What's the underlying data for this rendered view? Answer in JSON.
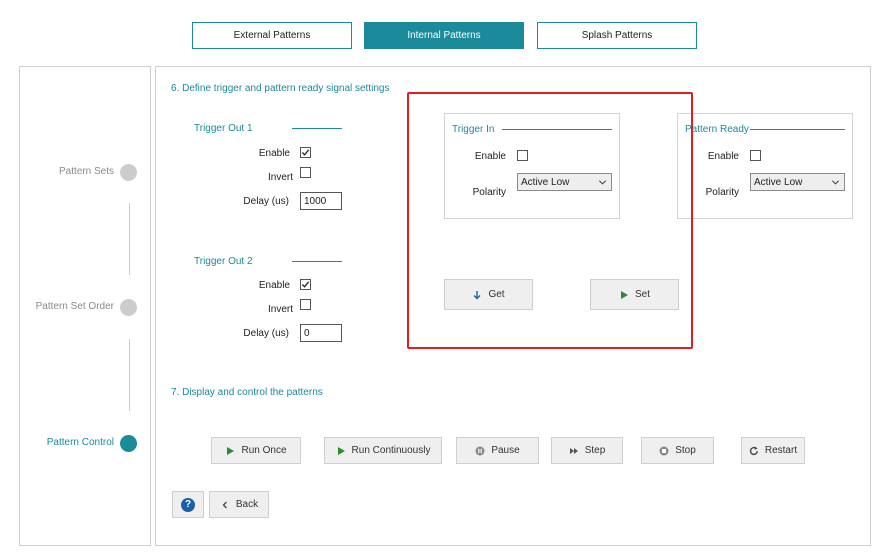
{
  "tabs": [
    {
      "label": "External Patterns",
      "active": false
    },
    {
      "label": "Internal Patterns",
      "active": true
    },
    {
      "label": "Splash Patterns",
      "active": false
    }
  ],
  "steps": [
    {
      "label": "Pattern Sets",
      "active": false
    },
    {
      "label": "Pattern Set Order",
      "active": false
    },
    {
      "label": "Pattern Control",
      "active": true
    }
  ],
  "section6": {
    "title": "6. Define trigger and pattern ready signal settings",
    "trigger_out_1": {
      "title": "Trigger Out 1",
      "enable_label": "Enable",
      "enable_checked": true,
      "invert_label": "Invert",
      "invert_checked": false,
      "delay_label": "Delay (us)",
      "delay_value": "1000"
    },
    "trigger_out_2": {
      "title": "Trigger Out 2",
      "enable_label": "Enable",
      "enable_checked": true,
      "invert_label": "Invert",
      "invert_checked": false,
      "delay_label": "Delay (us)",
      "delay_value": "0"
    },
    "trigger_in": {
      "title": "Trigger In",
      "enable_label": "Enable",
      "enable_checked": false,
      "polarity_label": "Polarity",
      "polarity_value": "Active Low"
    },
    "pattern_ready": {
      "title": "Pattern Ready",
      "enable_label": "Enable",
      "enable_checked": false,
      "polarity_label": "Polarity",
      "polarity_value": "Active Low"
    },
    "get_label": "Get",
    "set_label": "Set"
  },
  "section7": {
    "title": "7. Display and control the patterns",
    "buttons": {
      "run_once": "Run Once",
      "run_continuously": "Run Continuously",
      "pause": "Pause",
      "step": "Step",
      "stop": "Stop",
      "restart": "Restart"
    }
  },
  "footer": {
    "help_icon": "question-mark-icon",
    "back_label": "Back"
  },
  "colors": {
    "accent": "#1b8a9b",
    "highlight": "#e02020",
    "button_bg": "#efefef",
    "inactive_step": "#cccccc"
  }
}
